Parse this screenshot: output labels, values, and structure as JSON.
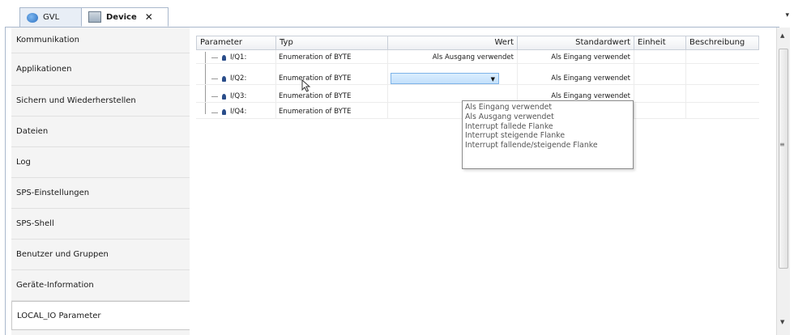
{
  "tabs": [
    {
      "label": "GVL",
      "icon": "globe-icon"
    },
    {
      "label": "Device",
      "icon": "device-icon",
      "close": "✕"
    }
  ],
  "tab_dropdown": "▾",
  "sidebar": {
    "items": [
      {
        "label": "Kommunikation"
      },
      {
        "label": "Applikationen"
      },
      {
        "label": "Sichern und Wiederherstellen"
      },
      {
        "label": "Dateien"
      },
      {
        "label": "Log"
      },
      {
        "label": "SPS-Einstellungen"
      },
      {
        "label": "SPS-Shell"
      },
      {
        "label": "Benutzer und Gruppen"
      },
      {
        "label": "Geräte-Information"
      },
      {
        "label": "LOCAL_IO Parameter"
      }
    ],
    "active_index": 9
  },
  "table": {
    "columns": [
      "Parameter",
      "Typ",
      "Wert",
      "Standardwert",
      "Einheit",
      "Beschreibung"
    ],
    "rows": [
      {
        "param": "I/Q1:",
        "typ": "Enumeration of BYTE",
        "wert": "Als Ausgang verwendet",
        "standard": "Als Eingang verwendet",
        "einheit": "",
        "beschreibung": ""
      },
      {
        "param": "I/Q2:",
        "typ": "Enumeration of BYTE",
        "wert": "",
        "standard": "Als Eingang verwendet",
        "einheit": "",
        "beschreibung": ""
      },
      {
        "param": "I/Q3:",
        "typ": "Enumeration of BYTE",
        "wert": "",
        "standard": "Als Eingang verwendet",
        "einheit": "",
        "beschreibung": ""
      },
      {
        "param": "I/Q4:",
        "typ": "Enumeration of BYTE",
        "wert": "",
        "standard": "",
        "einheit": "",
        "beschreibung": ""
      }
    ]
  },
  "dropdown_options": [
    "Als Eingang verwendet",
    "Als Ausgang verwendet",
    "Interrupt fallede Flanke",
    "Interrupt steigende Flanke",
    "Interrupt fallende/steigende Flanke"
  ]
}
